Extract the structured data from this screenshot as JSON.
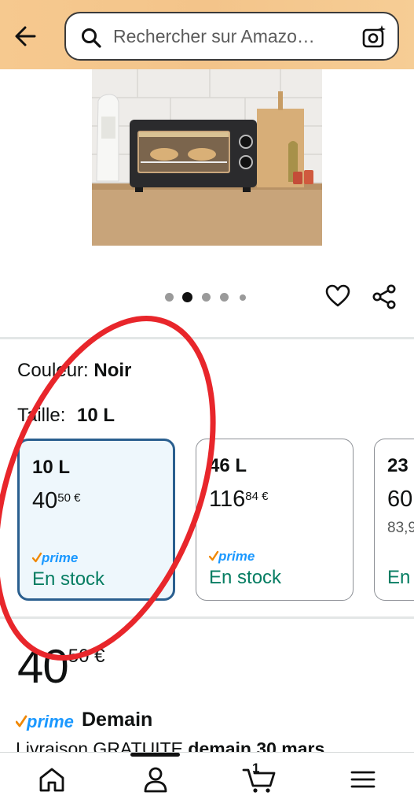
{
  "search": {
    "placeholder": "Rechercher sur Amazo…"
  },
  "gallery": {
    "dot_count": 5,
    "active_index": 1
  },
  "variations": {
    "color_label": "Couleur:",
    "color_value": "Noir",
    "size_label": "Taille:",
    "size_value": "10 L"
  },
  "size_options": [
    {
      "size": "10 L",
      "price_whole": "40",
      "price_frac": "50 €",
      "old_price": "",
      "stock": "En stock",
      "selected": true
    },
    {
      "size": "46 L",
      "price_whole": "116",
      "price_frac": "84 €",
      "old_price": "",
      "stock": "En stock",
      "selected": false
    },
    {
      "size": "23",
      "price_whole": "60",
      "price_frac": "",
      "old_price": "83,9",
      "stock": "En",
      "selected": false
    }
  ],
  "price": {
    "whole": "40",
    "frac": "50 €"
  },
  "delivery": {
    "prime_day": "Demain",
    "text_prefix": "Livraison GRATUITE",
    "text_bold": "demain 30 mars"
  },
  "cart": {
    "count": "1"
  },
  "icons": {
    "back": "arrow-left-icon",
    "search": "search-icon",
    "camera": "camera-search-icon",
    "heart": "heart-icon",
    "share": "share-icon",
    "home": "home-icon",
    "account": "person-icon",
    "cart": "cart-icon",
    "menu": "hamburger-menu-icon"
  },
  "colors": {
    "header_bg": "#f6c98f",
    "prime_blue": "#1a98ff",
    "stock_green": "#067d62",
    "selected_border": "#2a5f8f",
    "annotation_red": "#e8262b"
  }
}
